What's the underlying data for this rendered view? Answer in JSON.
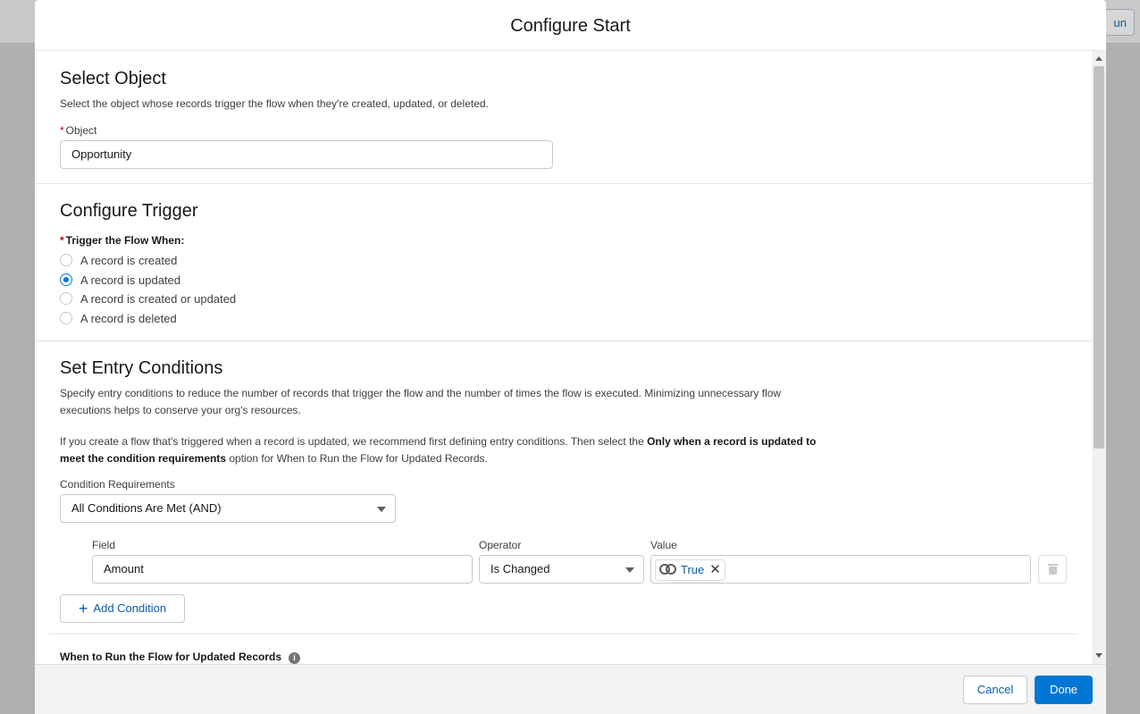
{
  "backdrop": {
    "button_label": "un"
  },
  "modal": {
    "title": "Configure Start"
  },
  "select_object": {
    "title": "Select Object",
    "description": "Select the object whose records trigger the flow when they're created, updated, or deleted.",
    "object_label": "Object",
    "object_value": "Opportunity"
  },
  "configure_trigger": {
    "title": "Configure Trigger",
    "trigger_label": "Trigger the Flow When:",
    "options": [
      {
        "label": "A record is created",
        "checked": false
      },
      {
        "label": "A record is updated",
        "checked": true
      },
      {
        "label": "A record is created or updated",
        "checked": false
      },
      {
        "label": "A record is deleted",
        "checked": false
      }
    ]
  },
  "entry_conditions": {
    "title": "Set Entry Conditions",
    "desc_line1": "Specify entry conditions to reduce the number of records that trigger the flow and the number of times the flow is executed. Minimizing unnecessary flow",
    "desc_line2": "executions helps to conserve your org's resources.",
    "note_part1": "If you create a flow that's triggered when a record is updated, we recommend first defining entry conditions. Then select the ",
    "note_bold1": "Only when a record is updated to",
    "note_bold2": "meet the condition requirements",
    "note_part2": " option for When to Run the Flow for Updated Records.",
    "requirements_label": "Condition Requirements",
    "requirements_value": "All Conditions Are Met (AND)",
    "field_label": "Field",
    "field_value": "Amount",
    "operator_label": "Operator",
    "operator_value": "Is Changed",
    "value_label": "Value",
    "value_pill": "True",
    "add_condition_label": "Add Condition",
    "when_to_run_label": "When to Run the Flow for Updated Records"
  },
  "footer": {
    "cancel_label": "Cancel",
    "done_label": "Done"
  },
  "colors": {
    "brand": "#0176d3",
    "link": "#0b5cab",
    "required": "#ba0517"
  }
}
